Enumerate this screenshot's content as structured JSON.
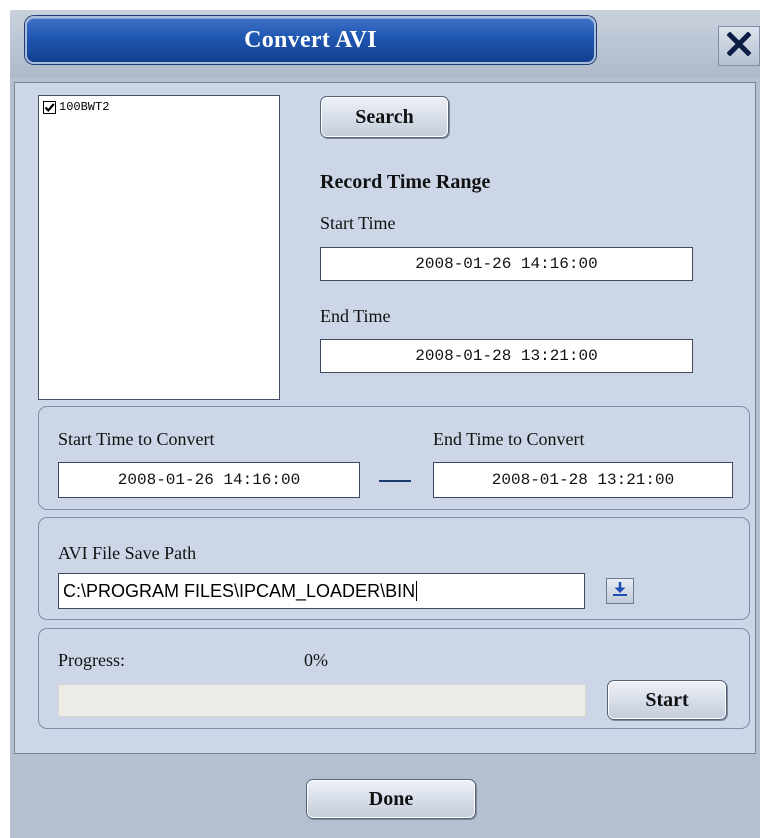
{
  "window": {
    "title": "Convert AVI",
    "close_icon": "close-icon"
  },
  "camera_list": {
    "items": [
      {
        "label": "100BWT2",
        "checked": true
      }
    ]
  },
  "search": {
    "button_label": "Search"
  },
  "record_range": {
    "heading": "Record Time Range",
    "start_label": "Start Time",
    "start_value": "2008-01-26 14:16:00",
    "end_label": "End Time",
    "end_value": "2008-01-28 13:21:00"
  },
  "convert_range": {
    "start_label": "Start Time to Convert",
    "start_value": "2008-01-26 14:16:00",
    "end_label": "End Time to Convert",
    "end_value": "2008-01-28 13:21:00"
  },
  "save_path": {
    "label": "AVI File Save Path",
    "value": "C:\\PROGRAM FILES\\IPCAM_LOADER\\BIN",
    "browse_icon": "download-arrow-icon"
  },
  "progress": {
    "label": "Progress:",
    "percent_text": "0%",
    "fraction": 0.0,
    "start_label": "Start"
  },
  "footer": {
    "done_label": "Done"
  },
  "colors": {
    "title_bar": "#1f56b1",
    "dialog_background": "#b4bfcf",
    "panel_background": "#ccd6e6"
  }
}
